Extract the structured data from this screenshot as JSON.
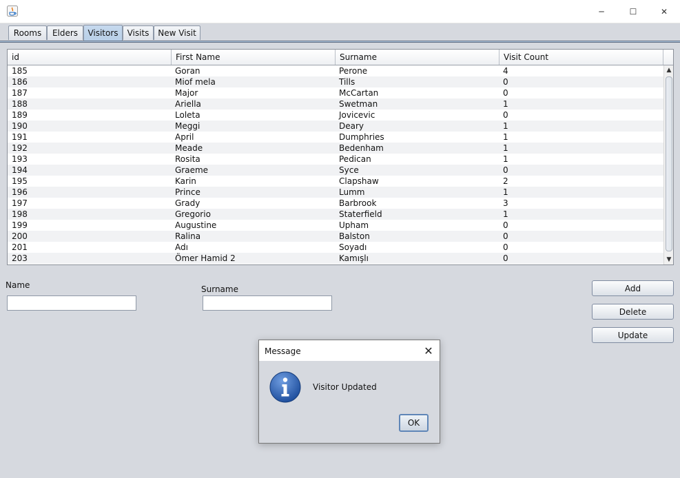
{
  "window": {
    "title": "",
    "controls": {
      "minimize_icon": "─",
      "maximize_icon": "☐",
      "close_icon": "✕"
    }
  },
  "tabs": [
    {
      "label": "Rooms",
      "selected": false
    },
    {
      "label": "Elders",
      "selected": false
    },
    {
      "label": "Visitors",
      "selected": true
    },
    {
      "label": "Visits",
      "selected": false
    },
    {
      "label": "New Visit",
      "selected": false
    }
  ],
  "table": {
    "columns": [
      "id",
      "First Name",
      "Surname",
      "Visit Count"
    ],
    "rows": [
      [
        "185",
        "Goran",
        "Perone",
        "4"
      ],
      [
        "186",
        "Miof mela",
        "Tills",
        "0"
      ],
      [
        "187",
        "Major",
        "McCartan",
        "0"
      ],
      [
        "188",
        "Ariella",
        "Swetman",
        "1"
      ],
      [
        "189",
        "Loleta",
        "Jovicevic",
        "0"
      ],
      [
        "190",
        "Meggi",
        "Deary",
        "1"
      ],
      [
        "191",
        "April",
        "Dumphries",
        "1"
      ],
      [
        "192",
        "Meade",
        "Bedenham",
        "1"
      ],
      [
        "193",
        "Rosita",
        "Pedican",
        "1"
      ],
      [
        "194",
        "Graeme",
        "Syce",
        "0"
      ],
      [
        "195",
        "Karin",
        "Clapshaw",
        "2"
      ],
      [
        "196",
        "Prince",
        "Lumm",
        "1"
      ],
      [
        "197",
        "Grady",
        "Barbrook",
        "3"
      ],
      [
        "198",
        "Gregorio",
        "Staterfield",
        "1"
      ],
      [
        "199",
        "Augustine",
        "Upham",
        "0"
      ],
      [
        "200",
        "Ralina",
        "Balston",
        "0"
      ],
      [
        "201",
        "Adı",
        "Soyadı",
        "0"
      ],
      [
        "203",
        "Ömer Hamid 2",
        "Kamışlı",
        "0"
      ]
    ],
    "scroll_up_icon": "▲",
    "scroll_down_icon": "▼"
  },
  "form": {
    "name_label": "Name",
    "name_value": "",
    "surname_label": "Surname",
    "surname_value": ""
  },
  "buttons": {
    "add": "Add",
    "delete": "Delete",
    "update": "Update"
  },
  "dialog": {
    "title": "Message",
    "close_icon": "✕",
    "message": "Visitor Updated",
    "ok": "OK",
    "icon": "info-icon"
  }
}
